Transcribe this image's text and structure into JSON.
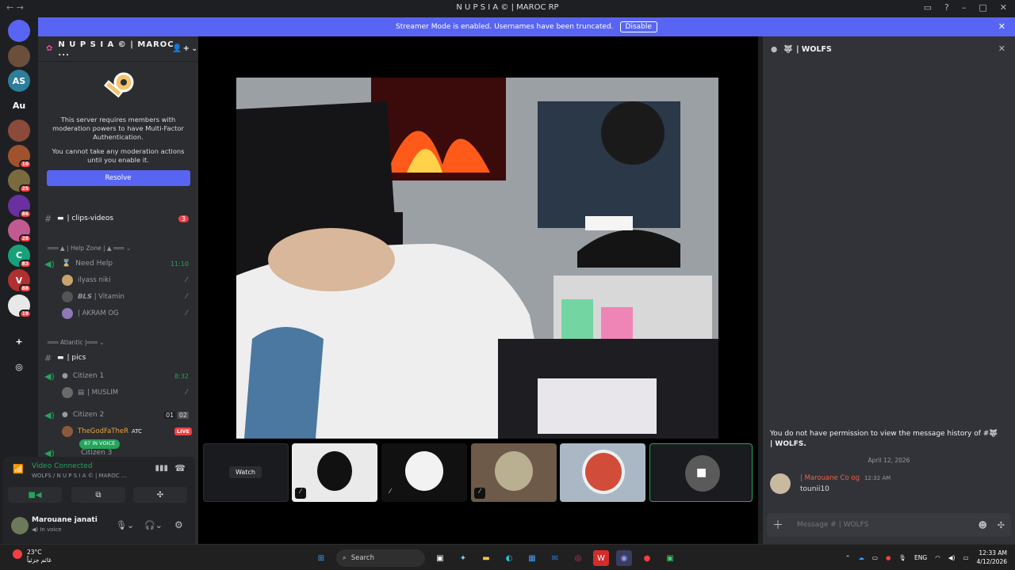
{
  "window": {
    "title": "N U P S I A © | MAROC RP"
  },
  "banner": {
    "text": "Streamer Mode is enabled. Usernames have been truncated.",
    "disable_label": "Disable"
  },
  "guilds": [
    {
      "label": "",
      "color": "#5865f2",
      "badge": ""
    },
    {
      "label": "",
      "color": "#6b4f3a",
      "badge": ""
    },
    {
      "label": "AS",
      "color": "#2e7d9a",
      "badge": ""
    },
    {
      "label": "Au",
      "color": "#1e1f22",
      "badge": ""
    },
    {
      "label": "",
      "color": "#8a4b3a",
      "badge": ""
    },
    {
      "label": "",
      "color": "#a0522d",
      "badge": "10"
    },
    {
      "label": "",
      "color": "#7a6a40",
      "badge": "25"
    },
    {
      "label": "",
      "color": "#6a2fa0",
      "badge": "86"
    },
    {
      "label": "",
      "color": "#c05a90",
      "badge": "28"
    },
    {
      "label": "C",
      "color": "#18a07a",
      "badge": "83"
    },
    {
      "label": "V",
      "color": "#b03030",
      "badge": "88"
    },
    {
      "label": "",
      "color": "#e8e8e8",
      "badge": "19"
    }
  ],
  "server": {
    "name": "N U P S I A © | MAROC ...",
    "mfa_line1": "This server requires members with moderation powers to have Multi-Factor Authentication.",
    "mfa_line2": "You cannot take any moderation actions until you enable it.",
    "resolve_label": "Resolve"
  },
  "channels": {
    "clips": {
      "name": "| clips-videos",
      "badge": "3"
    },
    "help_zone_cat": "Help Zone",
    "need_help": {
      "name": "Need Help",
      "time": "11:10"
    },
    "help_users": [
      {
        "name": "ilyass niki",
        "color": "#c9a36b"
      },
      {
        "name": "𝘽𝙇𝙎 | Vitamin",
        "color": "#555"
      },
      {
        "name": "| AKRAM OG",
        "color": "#8d78b8"
      }
    ],
    "atlantic_cat": "Atlantic |",
    "pics": {
      "name": "| pics"
    },
    "citizen1": {
      "name": "Citizen 1",
      "time": "8:32"
    },
    "citizen1_user": {
      "name": "| MUSLIM",
      "color": "#6a6a6a"
    },
    "citizen2": {
      "name": "Citizen 2",
      "left": "01",
      "right": "02"
    },
    "citizen2_user": {
      "name": "TheGodFaTheR",
      "tag": "ATC",
      "live": "LIVE",
      "color": "#8b5a3c"
    },
    "voice_pill": "87 IN VOICE",
    "citizen3": {
      "name": "Citizen 3"
    }
  },
  "voice": {
    "status": "Video Connected",
    "channel": "WOLFS / N U P S I A © | MAROC ..."
  },
  "user": {
    "name": "Marouane janati",
    "status": "In voice"
  },
  "stage": {
    "watch_label": "Watch"
  },
  "right": {
    "channel": "| WOLFS",
    "permission_text": "You do not have permission to view the message history of #",
    "permission_channel": "| WOLFS.",
    "date": "April 12, 2026",
    "message": {
      "author": "| Marouane Co og",
      "time": "12:32 AM",
      "text": "tounii10"
    },
    "composer_placeholder": "Message # | WOLFS"
  },
  "taskbar": {
    "temp": "23°C",
    "weather": "غائم جزئياً",
    "search": "Search",
    "lang": "ENG",
    "time": "12:33 AM",
    "date": "4/12/2026"
  }
}
